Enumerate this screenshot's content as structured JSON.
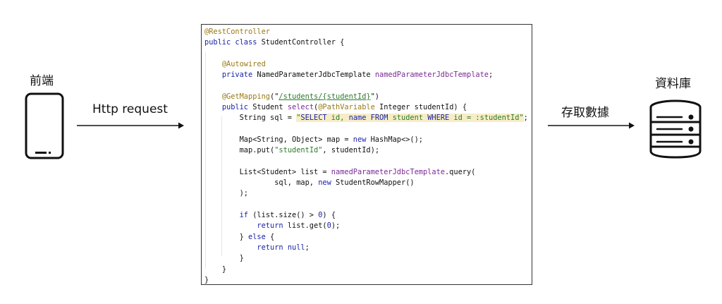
{
  "frontend": {
    "label": "前端"
  },
  "database": {
    "label": "資料庫"
  },
  "request_arrow": {
    "label": "Http request"
  },
  "db_arrow": {
    "label": "存取數據"
  },
  "code": {
    "annotation_rest": "@RestController",
    "class_kw": "public class ",
    "class_rest": "StudentController {",
    "annotation_autowired": "@Autowired",
    "field_kw": "private ",
    "field_type": "NamedParameterJdbcTemplate ",
    "field_name": "namedParameterJdbcTemplate",
    "field_end": ";",
    "annotation_get": "@GetMapping",
    "get_open": "(\"",
    "get_path": "/students/{studentId}",
    "get_close": "\")",
    "method_kw": "public ",
    "method_type": "Student ",
    "method_name": "select",
    "method_open": "(",
    "param_ann": "@PathVariable",
    "param_rest": " Integer studentId) {",
    "sql_decl": "String sql = ",
    "sql_q1": "\"",
    "sql_p1": "SELECT",
    "sql_p2": " id, ",
    "sql_p3": "name",
    "sql_p4": " ",
    "sql_p5": "FROM",
    "sql_p6": " student ",
    "sql_p7": "WHERE",
    "sql_p8": " id = :studentId",
    "sql_q2": "\"",
    "sql_end": ";",
    "map_decl": "Map<String, Object> map = ",
    "map_new": "new",
    "map_rest": " HashMap<>();",
    "put_start": "map.put(",
    "put_str": "\"studentId\"",
    "put_end": ", studentId);",
    "list_decl": "List<Student> list = ",
    "list_call": "namedParameterJdbcTemplate",
    "list_query": ".query(",
    "args_start": "sql, map, ",
    "args_new": "new",
    "args_rest": " StudentRowMapper()",
    "close_paren": ");",
    "if_kw": "if",
    "if_mid": " (list.size() > ",
    "if_num": "0",
    "if_end": ") {",
    "ret1_kw": "return",
    "ret1_mid": " list.get(",
    "ret1_num": "0",
    "ret1_end": ");",
    "else_start": "} ",
    "else_kw": "else",
    "else_end": " {",
    "ret2_kw": "return",
    "ret2_sp": " ",
    "ret2_null": "null",
    "ret2_end": ";",
    "brace_inner": "}",
    "brace_method": "}",
    "brace_class": "}"
  },
  "colors": {
    "annotation": "#9a7a14",
    "keyword": "#1a23a8",
    "member": "#7a2a96",
    "string": "#2e7a2e",
    "sql_highlight": "#f6edc6"
  }
}
